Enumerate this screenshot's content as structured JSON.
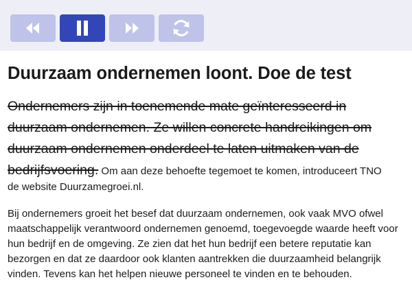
{
  "toolbar": {
    "buttons": [
      {
        "id": "rewind",
        "icon": "rewind-icon",
        "active": false
      },
      {
        "id": "pause",
        "icon": "pause-icon",
        "active": true
      },
      {
        "id": "forward",
        "icon": "fast-forward-icon",
        "active": false
      },
      {
        "id": "repeat",
        "icon": "repeat-icon",
        "active": false
      }
    ],
    "colors": {
      "inactive": "#bfc3ea",
      "active": "#3346b8",
      "bar": "#eeeef7"
    }
  },
  "article": {
    "title": "Duurzaam ondernemen loont. Doe de test",
    "lead_struck": "Ondernemers zijn in toenemende mate geïnteresseerd in duurzaam ondernemen. Ze willen concrete handreikingen om duurzaam ondernemen onderdeel te laten uitmaken van de bedrijfsvoering.",
    "lead_rest_inline": " Om aan deze behoefte tegemoet te komen, introduceert TNO",
    "lead_rest_line2": "de website Duurzamegroei.nl.",
    "paragraph": "Bij ondernemers groeit het besef dat duurzaam ondernemen, ook vaak MVO ofwel maatschappelijk verantwoord ondernemen genoemd, toegevoegde waarde heeft voor hun bedrijf en de omgeving. Ze zien dat het hun bedrijf een betere reputatie kan bezorgen en dat ze daardoor ook klanten aantrekken die duurzaamheid belangrijk vinden. Tevens kan het helpen nieuwe personeel te vinden en te behouden."
  }
}
